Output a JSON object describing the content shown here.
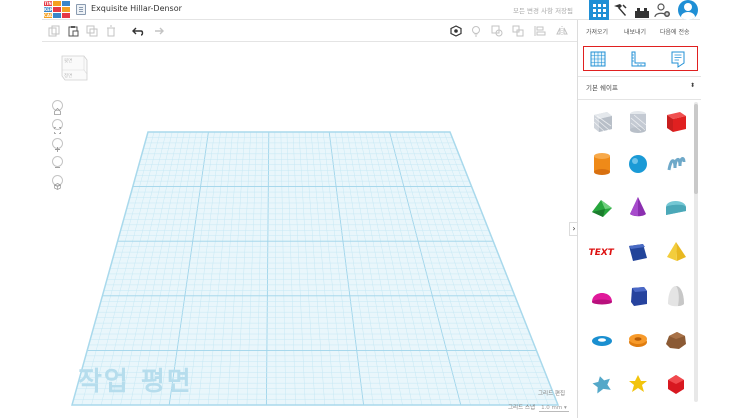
{
  "header": {
    "logo_letters": [
      "TIN",
      "KER",
      "CAD"
    ],
    "title": "Exquisite Hillar-Densor",
    "save_status": "모든 변경 사항 저장됨"
  },
  "right_panel": {
    "import_label": "가져오기",
    "export_label": "내보내기",
    "send_to_label": "다음에 전송",
    "category": "기본 쉐이프",
    "icons": [
      "workplane-icon",
      "ruler-icon",
      "notes-icon"
    ],
    "shapes": [
      "box-hole",
      "cylinder-hole",
      "box",
      "cylinder",
      "sphere",
      "scribble",
      "roof",
      "cone",
      "round-roof",
      "text",
      "wedge-box",
      "pyramid",
      "half-sphere",
      "polygon",
      "paraboloid",
      "torus",
      "tube",
      "rock",
      "star",
      "star-gold",
      "icosahedron"
    ]
  },
  "viewcube": {
    "top": "윗면",
    "front": "정면"
  },
  "workplane": {
    "label": "작업 평면",
    "edit_grid": "그리드 편집",
    "snap_label": "그리드 스냅",
    "snap_value": "1.0 mm"
  },
  "colors": {
    "accent": "#1f8fd5",
    "grid": "#bfe6f3",
    "highlight": "#e02020"
  }
}
